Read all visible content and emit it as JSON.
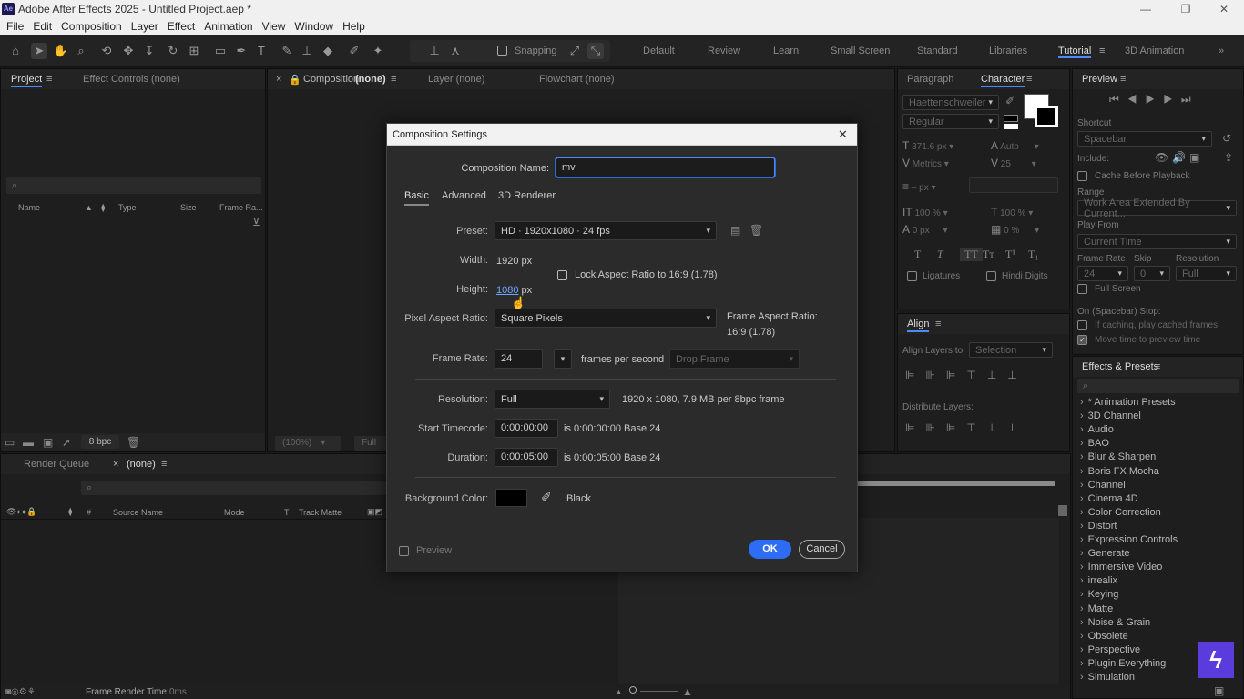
{
  "window": {
    "title": "Adobe After Effects 2025 - Untitled Project.aep *",
    "app_icon": "Ae",
    "min": "—",
    "max": "❐",
    "close": "✕"
  },
  "menu": [
    "File",
    "Edit",
    "Composition",
    "Layer",
    "Effect",
    "Animation",
    "View",
    "Window",
    "Help"
  ],
  "toolbar": {
    "snapping_label": "Snapping"
  },
  "workspaces": [
    "Default",
    "Review",
    "Learn",
    "Small Screen",
    "Standard",
    "Libraries",
    "Tutorial",
    "3D Animation"
  ],
  "workspace_active": "Tutorial",
  "project_panel": {
    "tabs": [
      "Project",
      "Effect Controls (none)"
    ],
    "columns": [
      "Name",
      "Type",
      "Size",
      "Frame Ra..."
    ],
    "bpc": "8 bpc"
  },
  "comp_panel": {
    "tabs": [
      "Composition",
      "(none)",
      "Layer (none)",
      "Flowchart (none)"
    ],
    "zoom": "(100%)",
    "res": "Full"
  },
  "timeline": {
    "tabs": [
      "Render Queue",
      "(none)"
    ],
    "columns": [
      "Source Name",
      "Mode",
      "T",
      "Track Matte"
    ],
    "status": "Frame Render Time:",
    "status_value": "0ms"
  },
  "character": {
    "tabs": [
      "Paragraph",
      "Character"
    ],
    "font": "Haettenschweiler",
    "style": "Regular",
    "size": "371.6 px",
    "leading": "Auto",
    "kerning": "Metrics",
    "tracking": "25",
    "stroke": "– px",
    "vscale": "100 %",
    "hscale": "100 %",
    "baseline": "0 px",
    "tsume": "0 %",
    "styles": [
      "T",
      "T",
      "TT",
      "Tт",
      "T¹",
      "T₁"
    ],
    "ligatures": "Ligatures",
    "hindi": "Hindi Digits"
  },
  "align": {
    "title": "Align",
    "align_to_label": "Align Layers to:",
    "align_to_value": "Selection",
    "distribute_label": "Distribute Layers:"
  },
  "preview": {
    "title": "Preview",
    "shortcut_label": "Shortcut",
    "shortcut_value": "Spacebar",
    "include_label": "Include:",
    "cache_label": "Cache Before Playback",
    "range_label": "Range",
    "range_value": "Work Area Extended By Current...",
    "playfrom_label": "Play From",
    "playfrom_value": "Current Time",
    "framerate_label": "Frame Rate",
    "skip_label": "Skip",
    "resolution_label": "Resolution",
    "framerate_value": "24",
    "skip_value": "0",
    "resolution_value": "Full",
    "fullscreen_label": "Full Screen",
    "onstop_label": "On (Spacebar) Stop:",
    "ifcaching_label": "If caching, play cached frames",
    "movetime_label": "Move time to preview time"
  },
  "effects": {
    "title": "Effects & Presets",
    "items": [
      "* Animation Presets",
      "3D Channel",
      "Audio",
      "BAO",
      "Blur & Sharpen",
      "Boris FX Mocha",
      "Channel",
      "Cinema 4D",
      "Color Correction",
      "Distort",
      "Expression Controls",
      "Generate",
      "Immersive Video",
      "irrealix",
      "Keying",
      "Matte",
      "Noise & Grain",
      "Obsolete",
      "Perspective",
      "Plugin Everything",
      "Simulation"
    ]
  },
  "dialog": {
    "title": "Composition Settings",
    "close": "✕",
    "comp_name_label": "Composition Name:",
    "comp_name_value": "mv",
    "tabs": [
      "Basic",
      "Advanced",
      "3D Renderer"
    ],
    "preset_label": "Preset:",
    "preset_value": "HD · 1920x1080 · 24 fps",
    "width_label": "Width:",
    "width_value": "1920",
    "height_label": "Height:",
    "height_value": "1080",
    "px": "px",
    "lock_label": "Lock Aspect Ratio to 16:9 (1.78)",
    "par_label": "Pixel Aspect Ratio:",
    "par_value": "Square Pixels",
    "far_label": "Frame Aspect Ratio:",
    "far_value": "16:9 (1.78)",
    "framerate_label": "Frame Rate:",
    "framerate_value": "24",
    "fps_label": "frames per second",
    "dropframe_value": "Drop Frame",
    "resolution_label": "Resolution:",
    "resolution_value": "Full",
    "resolution_info": "1920 x 1080, 7.9 MB per 8bpc frame",
    "start_label": "Start Timecode:",
    "start_value": "0:00:00:00",
    "start_info": "is 0:00:00:00  Base 24",
    "duration_label": "Duration:",
    "duration_value": "0:00:05:00",
    "duration_info": "is 0:00:05:00  Base 24",
    "bg_label": "Background Color:",
    "bg_name": "Black",
    "preview_label": "Preview",
    "ok": "OK",
    "cancel": "Cancel"
  },
  "colors": {
    "accent": "#2d6df6",
    "panel": "#1e1e1e",
    "dialog": "#2b2b2b"
  }
}
